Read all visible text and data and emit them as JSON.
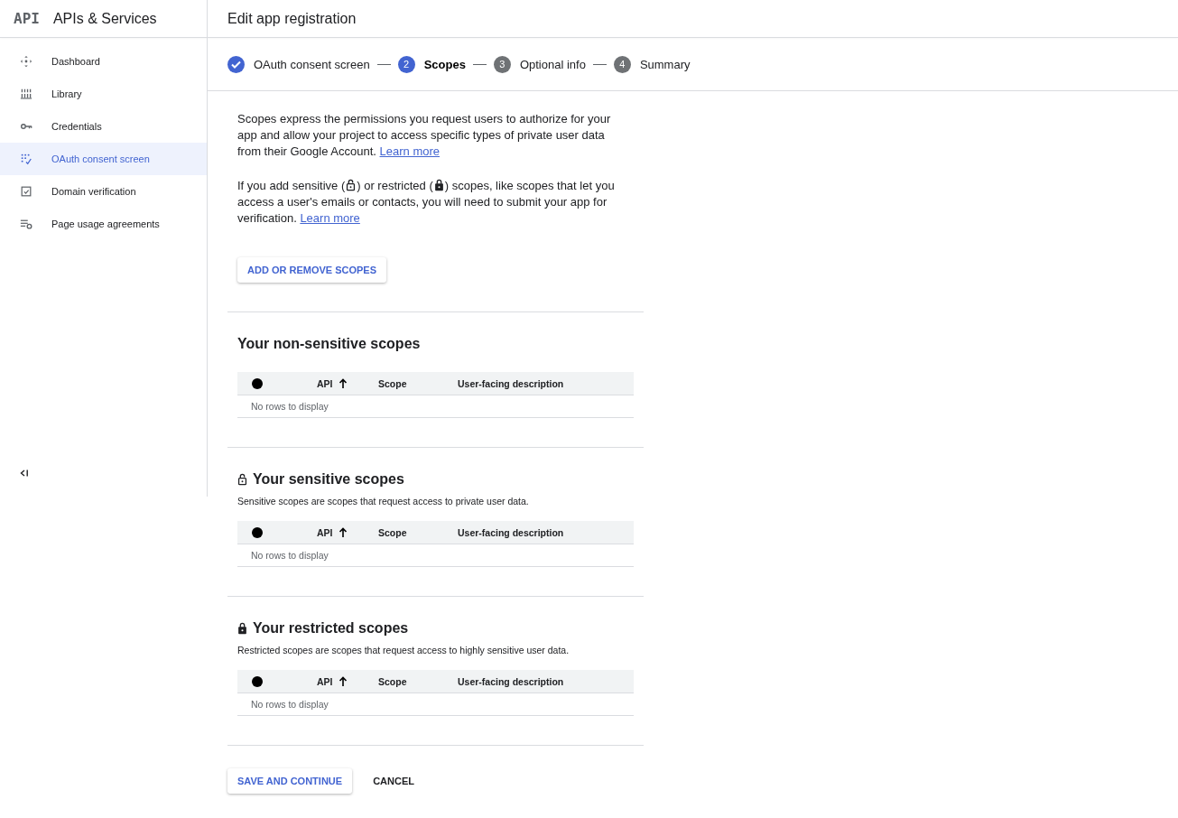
{
  "header": {
    "logo": "API",
    "title": "APIs & Services",
    "page_title": "Edit app registration"
  },
  "sidebar": {
    "items": [
      {
        "label": "Dashboard",
        "selected": false
      },
      {
        "label": "Library",
        "selected": false
      },
      {
        "label": "Credentials",
        "selected": false
      },
      {
        "label": "OAuth consent screen",
        "selected": true
      },
      {
        "label": "Domain verification",
        "selected": false
      },
      {
        "label": "Page usage agreements",
        "selected": false
      }
    ]
  },
  "stepper": [
    {
      "label": "OAuth consent screen",
      "done": true,
      "selected": false
    },
    {
      "number": "2",
      "label": "Scopes",
      "done": false,
      "selected": true
    },
    {
      "number": "3",
      "label": "Optional info",
      "done": false,
      "selected": false
    },
    {
      "number": "4",
      "label": "Summary",
      "done": false,
      "selected": false
    }
  ],
  "intro": [
    [
      {
        "kind": "text",
        "text": "Scopes express the permissions you request users to authorize for your app and allow your project to access specific types of private user data from their Google Account. "
      },
      {
        "kind": "link",
        "text": "Learn more"
      }
    ],
    [
      {
        "kind": "text",
        "text": "If you add sensitive ("
      },
      {
        "kind": "open_lock"
      },
      {
        "kind": "text",
        "text": ") or restricted ("
      },
      {
        "kind": "lock"
      },
      {
        "kind": "text",
        "text": ") scopes, like scopes that let you access a user's emails or contacts, you will need to submit your app for verification. "
      },
      {
        "kind": "link",
        "text": "Learn more"
      }
    ]
  ],
  "add_button": "ADD OR REMOVE SCOPES",
  "sections": [
    {
      "title": "Your non-sensitive scopes",
      "kind": "plain",
      "columns": [
        {
          "label": "API",
          "sorted": true
        },
        {
          "label": "Scope",
          "sorted": false
        },
        {
          "label": "User-facing description",
          "sorted": false
        }
      ],
      "empty_text": "No rows to display"
    },
    {
      "title": "Your sensitive scopes",
      "kind": "sensitive",
      "description": "Sensitive scopes are scopes that request access to private user data.",
      "columns": [
        {
          "label": "API",
          "sorted": true
        },
        {
          "label": "Scope",
          "sorted": false
        },
        {
          "label": "User-facing description",
          "sorted": false
        }
      ],
      "empty_text": "No rows to display"
    },
    {
      "title": "Your restricted scopes",
      "kind": "restricted",
      "description": "Restricted scopes are scopes that request access to highly sensitive user data.",
      "columns": [
        {
          "label": "API",
          "sorted": true
        },
        {
          "label": "Scope",
          "sorted": false
        },
        {
          "label": "User-facing description",
          "sorted": false
        }
      ],
      "empty_text": "No rows to display"
    }
  ],
  "actions": {
    "primary": "SAVE AND CONTINUE",
    "secondary": "CANCEL"
  }
}
